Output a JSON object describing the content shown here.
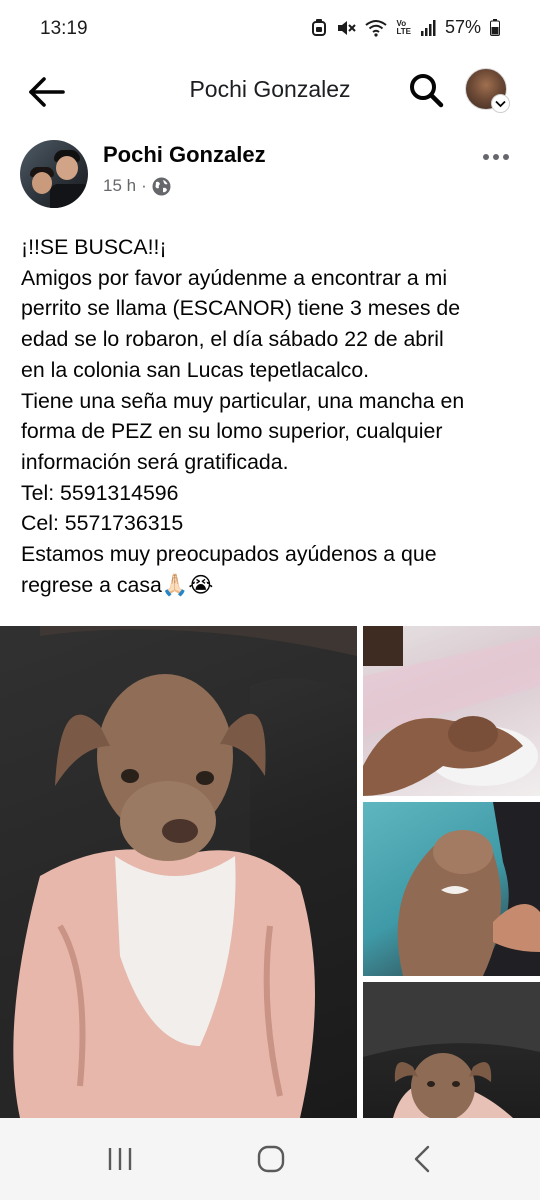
{
  "status_bar": {
    "time": "13:19",
    "lte_top": "Vo",
    "lte_bottom": "LTE",
    "battery": "57%",
    "icons": [
      "silent-mode-icon",
      "mute-icon",
      "wifi-icon",
      "signal-icon",
      "battery-icon"
    ]
  },
  "header": {
    "title": "Pochi Gonzalez",
    "icons": [
      "back-arrow-icon",
      "search-icon",
      "chevron-down-icon"
    ]
  },
  "post": {
    "author": "Pochi Gonzalez",
    "time": "15 h",
    "separator": "·",
    "privacy_icon": "globe-icon",
    "more_icon": "more-dots-icon",
    "lines": [
      "¡!!SE BUSCA!!¡",
      "Amigos por favor ayúdenme a encontrar a mi",
      "perrito se llama (ESCANOR)  tiene 3 meses de",
      "edad se lo robaron, el día sábado 22 de abril",
      "en la colonia san Lucas tepetlacalco.",
      "Tiene una seña muy particular, una mancha en",
      "forma de PEZ en su lomo superior, cualquier",
      "información será gratificada.",
      "Tel: 5591314596",
      "Cel: 5571736315",
      "Estamos muy preocupados ayúdenos a que",
      "regrese a casa🙏🏻😭"
    ]
  },
  "photos": [
    "puppy-jacket-photo",
    "puppy-blanket-photo",
    "puppy-back-mark-photo",
    "puppy-couch-photo"
  ],
  "nav_bar": {
    "icons": [
      "recent-apps-icon",
      "home-icon",
      "back-icon"
    ]
  }
}
